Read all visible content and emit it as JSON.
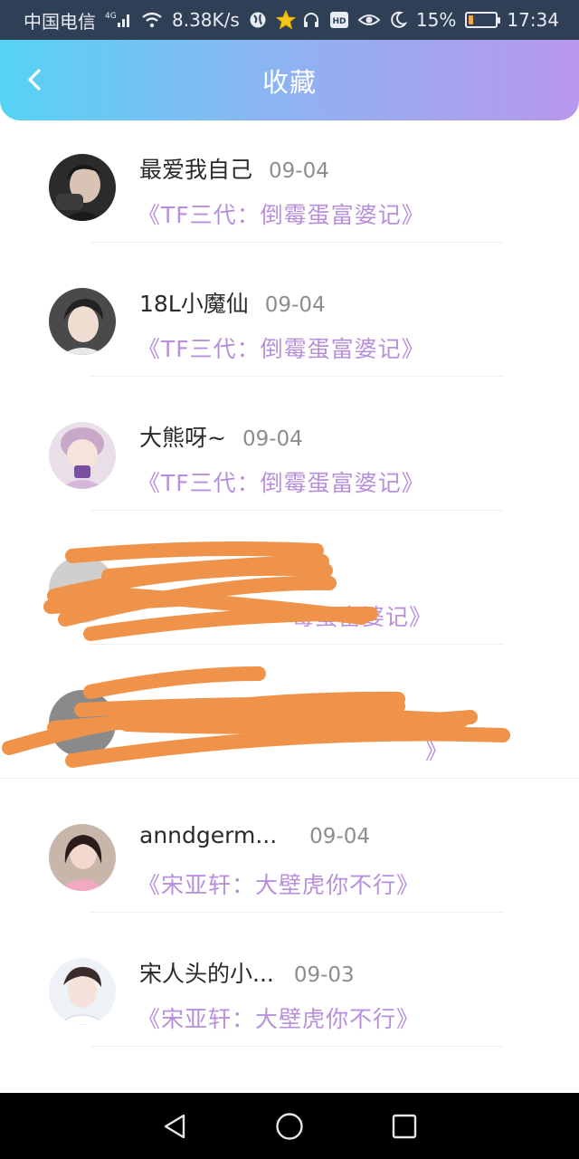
{
  "status_bar": {
    "carrier": "中国电信",
    "network": "4G",
    "speed": "8.38K/s",
    "battery": "15%",
    "battery_level": 0.15,
    "time": "17:34",
    "hd_label": "HD",
    "icons": [
      "signal-icon",
      "wifi-icon",
      "globe-icon",
      "star-icon",
      "headphones-icon",
      "hd-icon",
      "eye-icon",
      "moon-icon",
      "battery-icon"
    ]
  },
  "header": {
    "title": "收藏",
    "back_icon": "chevron-left-icon",
    "gradient": [
      "#56d3f4",
      "#b897ec"
    ]
  },
  "favorites": [
    {
      "name": "最爱我自己",
      "date": "09-04",
      "book": "《TF三代：倒霉蛋富婆记》"
    },
    {
      "name": "18L小魔仙",
      "date": "09-04",
      "book": "《TF三代：倒霉蛋富婆记》"
    },
    {
      "name": "大熊呀~",
      "date": "09-04",
      "book": "《TF三代：倒霉蛋富婆记》"
    },
    {
      "name": "",
      "date": "",
      "book": "霉蛋富婆记》"
    },
    {
      "name": "",
      "date": "",
      "book": "》"
    },
    {
      "name": "anndgerm...",
      "date": "09-04",
      "book": "《宋亚轩：大壁虎你不行》"
    },
    {
      "name": "宋人头的小...",
      "date": "09-03",
      "book": "《宋亚轩：大壁虎你不行》"
    }
  ],
  "colors": {
    "accent": "#b88fdc",
    "redaction": "#f0934a",
    "status_bar": "#2f3f55"
  },
  "nav_icons": [
    "back-triangle-icon",
    "home-circle-icon",
    "recents-square-icon"
  ]
}
